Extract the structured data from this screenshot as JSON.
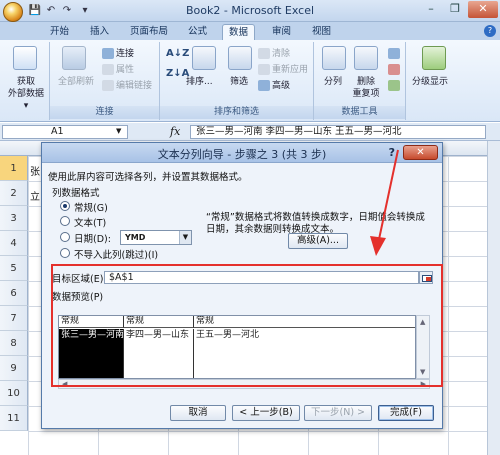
{
  "window": {
    "title": "Book2 - Microsoft Excel",
    "controls": {
      "minimize": "–",
      "restore": "❐",
      "close": "✕"
    }
  },
  "ribbon_tabs": [
    "开始",
    "插入",
    "页面布局",
    "公式",
    "数据",
    "审阅",
    "视图"
  ],
  "active_tab": "数据",
  "ribbon": {
    "get_external": {
      "label_line1": "获取",
      "label_line2": "外部数据▾"
    },
    "connections": {
      "refresh_all": "全部刷新",
      "connections": "连接",
      "properties": "属性",
      "edit_links": "编辑链接",
      "group_label": "连接"
    },
    "sort_filter": {
      "sort": "排序...",
      "filter": "筛选",
      "clear": "清除",
      "reapply": "重新应用",
      "advanced": "高级",
      "group_label": "排序和筛选"
    },
    "data_tools": {
      "text_to_columns": "分列",
      "remove_duplicates_line1": "删除",
      "remove_duplicates_line2": "重复项",
      "group_label": "数据工具"
    },
    "outline": {
      "label": "分级显示"
    }
  },
  "formula_bar": {
    "name_box": "A1",
    "fx": "fx",
    "formula": "张三—男—河南  李四—男—山东  王五—男—河北"
  },
  "sheet": {
    "rows": [
      "1",
      "2",
      "3",
      "4",
      "5",
      "6",
      "7",
      "8",
      "9",
      "10",
      "11"
    ],
    "cells": {
      "a1": "张",
      "a2": "立"
    }
  },
  "dialog": {
    "title": "文本分列向导 - 步骤之 3 (共 3 步)",
    "help": "?",
    "close": "✕",
    "instruction": "使用此屏内容可选择各列，并设置其数据格式。",
    "column_format_label": "列数据格式",
    "radio_options": [
      "常规(G)",
      "文本(T)",
      "日期(D):",
      "不导入此列(跳过)(I)"
    ],
    "selected_option": "常规(G)",
    "date_format": "YMD",
    "description_line1": "“常规”数据格式将数值转换成数字，日期值会转换成",
    "description_line2": "日期，其余数据则转换成文本。",
    "advanced_button": "高级(A)...",
    "destination_label": "目标区域(E):",
    "destination_value": "$A$1",
    "preview_label": "数据预览(P)",
    "preview_headers": [
      "常规",
      "常规",
      "常规"
    ],
    "preview_cells": [
      "张三—男—河南",
      "李四—男—山东",
      "王五—男—河北"
    ],
    "buttons": {
      "cancel": "取消",
      "back": "< 上一步(B)",
      "next": "下一步(N) >",
      "finish": "完成(F)"
    }
  },
  "annotation": {
    "highlight_color": "#e4302c"
  }
}
